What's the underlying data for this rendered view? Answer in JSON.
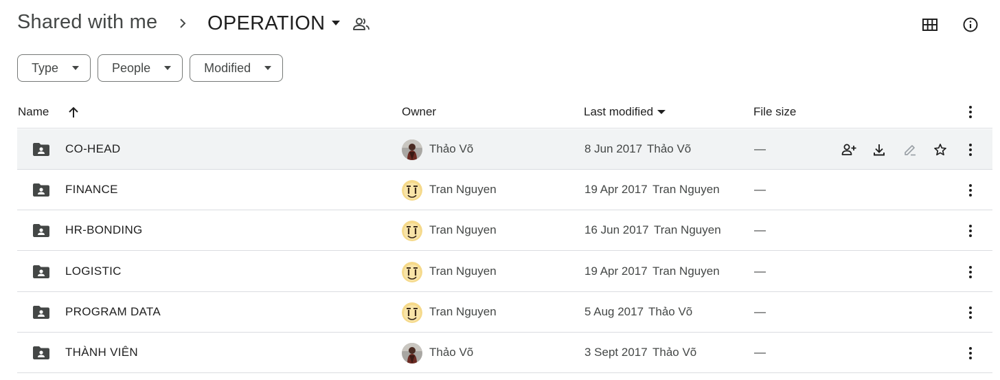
{
  "breadcrumb": {
    "root": "Shared with me",
    "current": "OPERATION"
  },
  "toolbar": {
    "icons": [
      "grid-view-icon",
      "info-icon"
    ]
  },
  "filters": [
    {
      "label": "Type"
    },
    {
      "label": "People"
    },
    {
      "label": "Modified"
    }
  ],
  "columns": {
    "name": "Name",
    "owner": "Owner",
    "last_modified": "Last modified",
    "file_size": "File size"
  },
  "sort": {
    "column": "name",
    "direction": "ascending"
  },
  "rows": [
    {
      "name": "CO-HEAD",
      "owner": "Thảo Võ",
      "owner_avatar": "photo",
      "modified_date": "8 Jun 2017",
      "modified_by": "Thảo Võ",
      "size": "—"
    },
    {
      "name": "FINANCE",
      "owner": "Tran Nguyen",
      "owner_avatar": "cartoon",
      "modified_date": "19 Apr 2017",
      "modified_by": "Tran Nguyen",
      "size": "—"
    },
    {
      "name": "HR-BONDING",
      "owner": "Tran Nguyen",
      "owner_avatar": "cartoon",
      "modified_date": "16 Jun 2017",
      "modified_by": "Tran Nguyen",
      "size": "—"
    },
    {
      "name": "LOGISTIC",
      "owner": "Tran Nguyen",
      "owner_avatar": "cartoon",
      "modified_date": "19 Apr 2017",
      "modified_by": "Tran Nguyen",
      "size": "—"
    },
    {
      "name": "PROGRAM DATA",
      "owner": "Tran Nguyen",
      "owner_avatar": "cartoon",
      "modified_date": "5 Aug 2017",
      "modified_by": "Thảo Võ",
      "size": "—"
    },
    {
      "name": "THÀNH VIÊN",
      "owner": "Thảo Võ",
      "owner_avatar": "photo",
      "modified_date": "3 Sept 2017",
      "modified_by": "Thảo Võ",
      "size": "—"
    }
  ],
  "hover_row_actions": [
    "share-icon",
    "download-icon",
    "rename-icon",
    "star-icon"
  ],
  "colors": {
    "hover_row": "#f1f3f4",
    "divider": "#dadce0",
    "icon": "#444746"
  }
}
